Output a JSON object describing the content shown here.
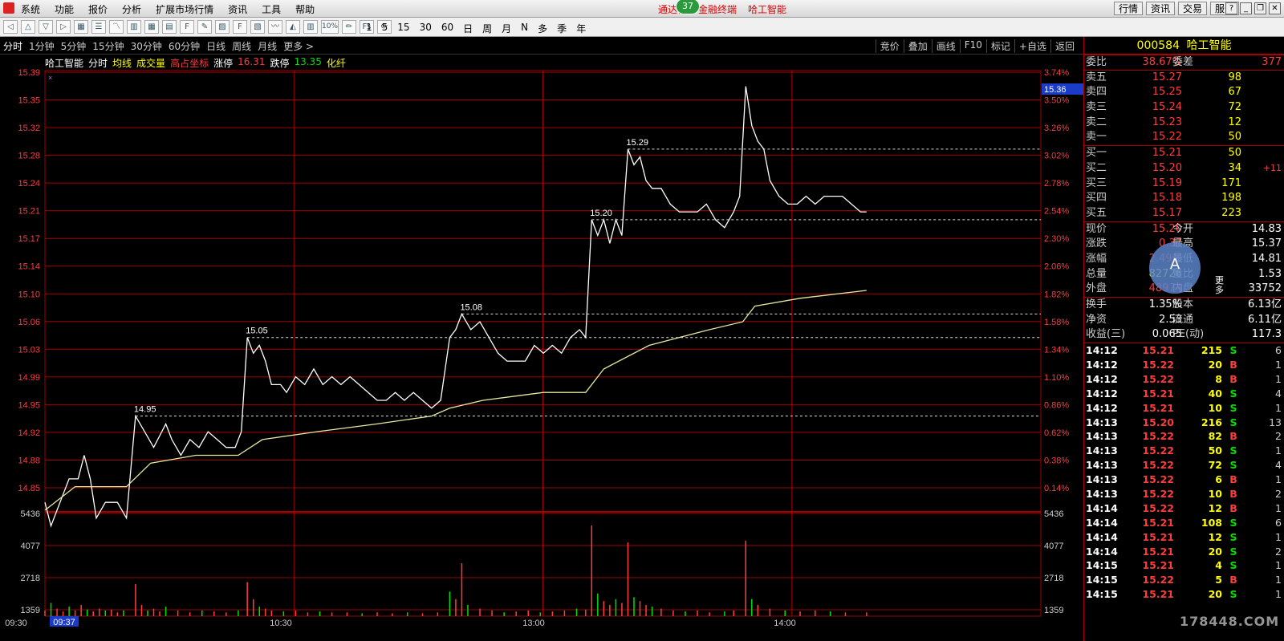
{
  "menubar": {
    "items": [
      "系统",
      "功能",
      "报价",
      "分析",
      "扩展市场行情",
      "资讯",
      "工具",
      "帮助"
    ],
    "title_left": "通达信",
    "title_mid": "金融终端",
    "title_stock": "哈工智能",
    "badge": "37",
    "right_buttons": [
      "行情",
      "资讯",
      "交易",
      "服务"
    ]
  },
  "toolbar": {
    "periods": [
      "1",
      "5",
      "15",
      "30",
      "60",
      "日",
      "周",
      "月",
      "N",
      "多",
      "季",
      "年"
    ],
    "pct_label": "10%"
  },
  "period_tabs": [
    "分时",
    "1分钟",
    "5分钟",
    "15分钟",
    "30分钟",
    "60分钟",
    "日线",
    "周线",
    "月线",
    "更多 >"
  ],
  "right_tabs": [
    "竞价",
    "叠加",
    "画线",
    "F10",
    "标记",
    "+自选",
    "返回"
  ],
  "chart_info": {
    "name": "哈工智能",
    "mode": "分时",
    "avg": "均线",
    "vol": "成交量",
    "hlc": "高占坐标",
    "limit_up_label": "涨停",
    "limit_up": "16.31",
    "limit_down_label": "跌停",
    "limit_down": "13.35",
    "sector": "化纤"
  },
  "chart_data": {
    "type": "line",
    "title": "哈工智能 分时",
    "price_ticks": [
      "15.39",
      "15.35",
      "15.32",
      "15.28",
      "15.24",
      "15.21",
      "15.17",
      "15.14",
      "15.10",
      "15.06",
      "15.03",
      "14.99",
      "14.95",
      "14.92",
      "14.88",
      "14.85"
    ],
    "pct_ticks": [
      "3.74%",
      "3.50%",
      "3.26%",
      "3.02%",
      "2.78%",
      "2.54%",
      "2.30%",
      "2.06%",
      "1.82%",
      "1.58%",
      "1.34%",
      "1.10%",
      "0.86%",
      "0.62%",
      "0.38%",
      "0.14%"
    ],
    "vol_ticks": [
      "5436",
      "4077",
      "2718",
      "1359"
    ],
    "time_ticks": [
      "09:30",
      "09:37",
      "10:30",
      "13:00",
      "14:00"
    ],
    "current_price_label": "15.36",
    "ylim": [
      14.83,
      15.39
    ],
    "annotations": [
      {
        "label": "14.95",
        "t": 30,
        "price": 14.95
      },
      {
        "label": "15.05",
        "t": 67,
        "price": 15.05
      },
      {
        "label": "15.08",
        "t": 138,
        "price": 15.08
      },
      {
        "label": "15.20",
        "t": 181,
        "price": 15.2
      },
      {
        "label": "15.29",
        "t": 193,
        "price": 15.29
      }
    ],
    "series": [
      {
        "name": "价格",
        "points": [
          [
            0,
            14.84
          ],
          [
            2,
            14.81
          ],
          [
            5,
            14.84
          ],
          [
            8,
            14.87
          ],
          [
            11,
            14.87
          ],
          [
            13,
            14.9
          ],
          [
            15,
            14.87
          ],
          [
            17,
            14.82
          ],
          [
            20,
            14.84
          ],
          [
            24,
            14.84
          ],
          [
            27,
            14.82
          ],
          [
            30,
            14.95
          ],
          [
            33,
            14.93
          ],
          [
            36,
            14.91
          ],
          [
            40,
            14.94
          ],
          [
            42,
            14.92
          ],
          [
            45,
            14.9
          ],
          [
            48,
            14.92
          ],
          [
            51,
            14.91
          ],
          [
            54,
            14.93
          ],
          [
            57,
            14.92
          ],
          [
            60,
            14.91
          ],
          [
            63,
            14.91
          ],
          [
            65,
            14.93
          ],
          [
            67,
            15.05
          ],
          [
            69,
            15.03
          ],
          [
            71,
            15.04
          ],
          [
            73,
            15.02
          ],
          [
            75,
            14.99
          ],
          [
            78,
            14.99
          ],
          [
            80,
            14.98
          ],
          [
            83,
            15.0
          ],
          [
            86,
            14.99
          ],
          [
            89,
            15.01
          ],
          [
            92,
            14.99
          ],
          [
            95,
            15.0
          ],
          [
            98,
            14.99
          ],
          [
            101,
            15.0
          ],
          [
            104,
            14.99
          ],
          [
            107,
            14.98
          ],
          [
            110,
            14.97
          ],
          [
            113,
            14.97
          ],
          [
            116,
            14.98
          ],
          [
            119,
            14.97
          ],
          [
            122,
            14.98
          ],
          [
            125,
            14.97
          ],
          [
            128,
            14.96
          ],
          [
            131,
            14.97
          ],
          [
            134,
            15.05
          ],
          [
            136,
            15.06
          ],
          [
            138,
            15.08
          ],
          [
            141,
            15.06
          ],
          [
            144,
            15.07
          ],
          [
            147,
            15.05
          ],
          [
            150,
            15.03
          ],
          [
            153,
            15.02
          ],
          [
            156,
            15.02
          ],
          [
            159,
            15.02
          ],
          [
            162,
            15.04
          ],
          [
            165,
            15.03
          ],
          [
            168,
            15.04
          ],
          [
            171,
            15.03
          ],
          [
            174,
            15.05
          ],
          [
            177,
            15.06
          ],
          [
            179,
            15.05
          ],
          [
            181,
            15.2
          ],
          [
            183,
            15.18
          ],
          [
            185,
            15.2
          ],
          [
            187,
            15.17
          ],
          [
            189,
            15.2
          ],
          [
            191,
            15.18
          ],
          [
            193,
            15.29
          ],
          [
            195,
            15.27
          ],
          [
            197,
            15.28
          ],
          [
            199,
            15.25
          ],
          [
            201,
            15.24
          ],
          [
            204,
            15.24
          ],
          [
            207,
            15.22
          ],
          [
            210,
            15.21
          ],
          [
            213,
            15.21
          ],
          [
            216,
            15.21
          ],
          [
            219,
            15.22
          ],
          [
            222,
            15.2
          ],
          [
            225,
            15.19
          ],
          [
            228,
            15.21
          ],
          [
            230,
            15.23
          ],
          [
            232,
            15.37
          ],
          [
            234,
            15.32
          ],
          [
            236,
            15.3
          ],
          [
            238,
            15.29
          ],
          [
            240,
            15.25
          ],
          [
            243,
            15.23
          ],
          [
            246,
            15.22
          ],
          [
            249,
            15.22
          ],
          [
            252,
            15.23
          ],
          [
            255,
            15.22
          ],
          [
            258,
            15.23
          ],
          [
            261,
            15.23
          ],
          [
            264,
            15.23
          ],
          [
            267,
            15.22
          ],
          [
            270,
            15.21
          ],
          [
            272,
            15.21
          ]
        ]
      },
      {
        "name": "均价",
        "points": [
          [
            0,
            14.83
          ],
          [
            10,
            14.86
          ],
          [
            20,
            14.86
          ],
          [
            27,
            14.86
          ],
          [
            35,
            14.89
          ],
          [
            50,
            14.9
          ],
          [
            64,
            14.9
          ],
          [
            72,
            14.92
          ],
          [
            90,
            14.93
          ],
          [
            110,
            14.94
          ],
          [
            128,
            14.95
          ],
          [
            134,
            14.96
          ],
          [
            145,
            14.97
          ],
          [
            165,
            14.98
          ],
          [
            179,
            14.98
          ],
          [
            185,
            15.01
          ],
          [
            200,
            15.04
          ],
          [
            220,
            15.06
          ],
          [
            231,
            15.07
          ],
          [
            235,
            15.09
          ],
          [
            250,
            15.1
          ],
          [
            272,
            15.11
          ]
        ]
      }
    ],
    "volume": [
      [
        0,
        300
      ],
      [
        2,
        700
      ],
      [
        4,
        400
      ],
      [
        6,
        250
      ],
      [
        8,
        500
      ],
      [
        10,
        300
      ],
      [
        12,
        600
      ],
      [
        14,
        350
      ],
      [
        16,
        250
      ],
      [
        18,
        400
      ],
      [
        20,
        300
      ],
      [
        22,
        350
      ],
      [
        24,
        200
      ],
      [
        26,
        300
      ],
      [
        30,
        1700
      ],
      [
        32,
        600
      ],
      [
        34,
        300
      ],
      [
        36,
        400
      ],
      [
        38,
        250
      ],
      [
        40,
        500
      ],
      [
        44,
        300
      ],
      [
        48,
        200
      ],
      [
        52,
        300
      ],
      [
        56,
        250
      ],
      [
        60,
        200
      ],
      [
        64,
        300
      ],
      [
        67,
        1800
      ],
      [
        69,
        900
      ],
      [
        71,
        500
      ],
      [
        73,
        400
      ],
      [
        75,
        300
      ],
      [
        79,
        250
      ],
      [
        83,
        300
      ],
      [
        87,
        200
      ],
      [
        91,
        250
      ],
      [
        95,
        200
      ],
      [
        100,
        200
      ],
      [
        105,
        150
      ],
      [
        110,
        200
      ],
      [
        115,
        150
      ],
      [
        120,
        200
      ],
      [
        125,
        150
      ],
      [
        130,
        200
      ],
      [
        134,
        1300
      ],
      [
        136,
        900
      ],
      [
        138,
        2800
      ],
      [
        140,
        600
      ],
      [
        144,
        400
      ],
      [
        148,
        300
      ],
      [
        152,
        200
      ],
      [
        156,
        250
      ],
      [
        160,
        300
      ],
      [
        164,
        200
      ],
      [
        168,
        250
      ],
      [
        172,
        300
      ],
      [
        176,
        400
      ],
      [
        179,
        350
      ],
      [
        181,
        4800
      ],
      [
        183,
        1200
      ],
      [
        185,
        800
      ],
      [
        187,
        600
      ],
      [
        189,
        900
      ],
      [
        191,
        700
      ],
      [
        193,
        3900
      ],
      [
        195,
        1000
      ],
      [
        197,
        800
      ],
      [
        199,
        600
      ],
      [
        201,
        500
      ],
      [
        204,
        400
      ],
      [
        208,
        300
      ],
      [
        212,
        250
      ],
      [
        216,
        300
      ],
      [
        220,
        200
      ],
      [
        225,
        250
      ],
      [
        228,
        300
      ],
      [
        232,
        4000
      ],
      [
        234,
        900
      ],
      [
        236,
        600
      ],
      [
        240,
        400
      ],
      [
        245,
        300
      ],
      [
        250,
        250
      ],
      [
        255,
        300
      ],
      [
        260,
        250
      ],
      [
        265,
        200
      ],
      [
        272,
        200
      ]
    ]
  },
  "quote": {
    "code": "000584",
    "name": "哈工智能",
    "weibi_label": "委比",
    "weibi": "38.67%",
    "weicha_label": "委差",
    "weicha": "377",
    "asks": [
      {
        "label": "卖五",
        "price": "15.27",
        "vol": "98"
      },
      {
        "label": "卖四",
        "price": "15.25",
        "vol": "67"
      },
      {
        "label": "卖三",
        "price": "15.24",
        "vol": "72"
      },
      {
        "label": "卖二",
        "price": "15.23",
        "vol": "12"
      },
      {
        "label": "卖一",
        "price": "15.22",
        "vol": "50"
      }
    ],
    "bids": [
      {
        "label": "买一",
        "price": "15.21",
        "vol": "50",
        "chg": ""
      },
      {
        "label": "买二",
        "price": "15.20",
        "vol": "34",
        "chg": "+11"
      },
      {
        "label": "买三",
        "price": "15.19",
        "vol": "171",
        "chg": ""
      },
      {
        "label": "买四",
        "price": "15.18",
        "vol": "198",
        "chg": ""
      },
      {
        "label": "买五",
        "price": "15.17",
        "vol": "223",
        "chg": ""
      }
    ],
    "stats": [
      {
        "a": "现价",
        "b": "15.20",
        "c": "今开",
        "d": "14.83"
      },
      {
        "a": "涨跌",
        "b": "0.37",
        "c": "最高",
        "d": "15.37"
      },
      {
        "a": "涨幅",
        "b": "2.49%",
        "c": "最低",
        "d": "14.81"
      },
      {
        "a": "总量",
        "b": "82726",
        "c": "量比",
        "d": "1.53"
      },
      {
        "a": "外盘",
        "b": "48974",
        "c": "内盘",
        "d": "33752"
      }
    ],
    "stats2": [
      {
        "a": "换手",
        "b": "1.35%",
        "c": "股本",
        "d": "6.13亿"
      },
      {
        "a": "净资",
        "b": "2.53",
        "c": "流通",
        "d": "6.11亿"
      },
      {
        "a": "收益(三)",
        "b": "0.065",
        "c": "PE(动)",
        "d": "117.3"
      }
    ],
    "ticks": [
      {
        "t": "14:12",
        "p": "15.21",
        "v": "215",
        "s": "S",
        "n": "6"
      },
      {
        "t": "14:12",
        "p": "15.22",
        "v": "20",
        "s": "B",
        "n": "1"
      },
      {
        "t": "14:12",
        "p": "15.22",
        "v": "8",
        "s": "B",
        "n": "1"
      },
      {
        "t": "14:12",
        "p": "15.21",
        "v": "40",
        "s": "S",
        "n": "4"
      },
      {
        "t": "14:12",
        "p": "15.21",
        "v": "10",
        "s": "S",
        "n": "1"
      },
      {
        "t": "14:13",
        "p": "15.20",
        "v": "216",
        "s": "S",
        "n": "13"
      },
      {
        "t": "14:13",
        "p": "15.22",
        "v": "82",
        "s": "B",
        "n": "2"
      },
      {
        "t": "14:13",
        "p": "15.22",
        "v": "50",
        "s": "S",
        "n": "1"
      },
      {
        "t": "14:13",
        "p": "15.22",
        "v": "72",
        "s": "S",
        "n": "4"
      },
      {
        "t": "14:13",
        "p": "15.22",
        "v": "6",
        "s": "B",
        "n": "1"
      },
      {
        "t": "14:13",
        "p": "15.22",
        "v": "10",
        "s": "B",
        "n": "2"
      },
      {
        "t": "14:14",
        "p": "15.22",
        "v": "12",
        "s": "B",
        "n": "1"
      },
      {
        "t": "14:14",
        "p": "15.21",
        "v": "108",
        "s": "S",
        "n": "6"
      },
      {
        "t": "14:14",
        "p": "15.21",
        "v": "12",
        "s": "S",
        "n": "1"
      },
      {
        "t": "14:14",
        "p": "15.21",
        "v": "20",
        "s": "S",
        "n": "2"
      },
      {
        "t": "14:15",
        "p": "15.21",
        "v": "4",
        "s": "S",
        "n": "1"
      },
      {
        "t": "14:15",
        "p": "15.22",
        "v": "5",
        "s": "B",
        "n": "1"
      },
      {
        "t": "14:15",
        "p": "15.21",
        "v": "20",
        "s": "S",
        "n": "1"
      }
    ]
  },
  "overlay": {
    "letter": "A",
    "more": "更多"
  },
  "watermark": "178448.COM",
  "colors": {
    "up": "#ff3c3c",
    "down": "#00e000",
    "grid": "#a00000",
    "price_line": "#ffffff",
    "avg_line": "#e8e8a0"
  }
}
